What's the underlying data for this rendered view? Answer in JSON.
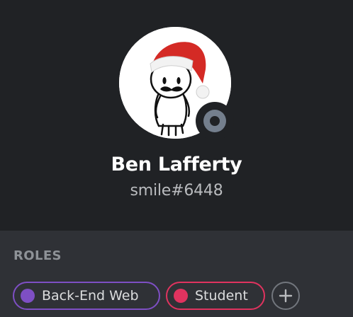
{
  "profile": {
    "display_name": "Ben Lafferty",
    "tag": "smile#6448",
    "status": "offline"
  },
  "roles_section": {
    "title": "ROLES",
    "roles": [
      {
        "name": "Back-End Web",
        "color": "#7e4fc4"
      },
      {
        "name": "Student",
        "color": "#e0335f"
      }
    ],
    "add_icon": "plus-icon"
  },
  "colors": {
    "header_bg": "#202225",
    "body_bg": "#2f3136",
    "offline_status": "#747f8d"
  }
}
